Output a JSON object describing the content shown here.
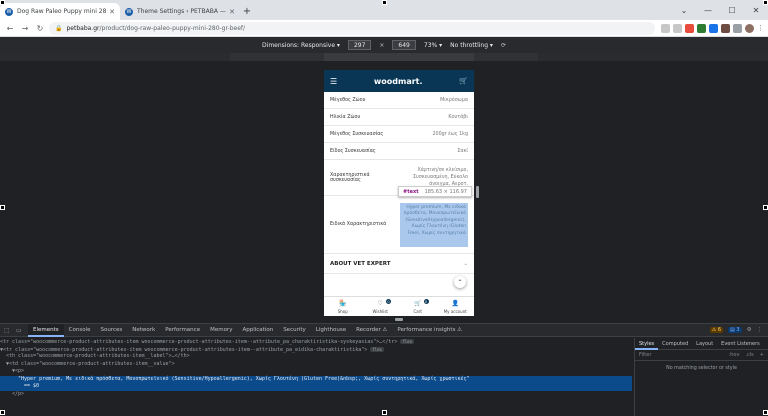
{
  "browser": {
    "tabs": [
      {
        "title": "Dog Raw Paleo Puppy mini 280 g",
        "active": true
      },
      {
        "title": "Theme Settings ‹ PETBABA — W",
        "active": false
      }
    ],
    "new_tab": "+",
    "url_host": "petbaba.gr",
    "url_path": "/product/dog-raw-paleo-puppy-mini-280-gr-beef/"
  },
  "device_toolbar": {
    "dimensions_label": "Dimensions: Responsive ▾",
    "width": "297",
    "height": "649",
    "times": "×",
    "zoom": "73% ▾",
    "throttle": "No throttling ▾"
  },
  "phone": {
    "logo": "woodmart.",
    "rows": [
      {
        "label": "Μέγεθος Ζώου",
        "value": "Μικρόσωμα"
      },
      {
        "label": "Ηλικία Ζώου",
        "value": "Κουτάβι"
      },
      {
        "label": "Μέγεθος Συσκευασίας",
        "value": "200gr έως 1kg"
      },
      {
        "label": "Είδος Συσκευασίας",
        "value": "Σακί"
      }
    ],
    "tall_row": {
      "label": "Χαρακτηριστικά συσκευασίας",
      "value": "Χάρτινη/σε κλείσιμο, Συσκευασμένη, Εύκολο άνοιγμα, Αεροτ."
    },
    "special_row": {
      "label": "Ειδικά Χαρακτηριστικά",
      "value": "Hyper premium, Με ειδικά πρόσθετα, Μονοπρωτεϊνικό (Sensitive/Hypoallergenic), Χωρίς Γλουτένη (Gluten Free), Χωρίς συντηρητικά"
    },
    "tooltip_tag": "#text",
    "tooltip_dims": "185.63 × 116.97",
    "vet_label": "ABOUT VET EXPERT",
    "vet_chevron": "⌄",
    "nav": [
      {
        "icon": "🏪",
        "label": "Shop",
        "badge": ""
      },
      {
        "icon": "♡",
        "label": "Wishlist",
        "badge": "0"
      },
      {
        "icon": "🛒",
        "label": "Cart",
        "badge": "0"
      },
      {
        "icon": "👤",
        "label": "My account",
        "badge": ""
      }
    ]
  },
  "devtools": {
    "tabs": [
      "Elements",
      "Console",
      "Sources",
      "Network",
      "Performance",
      "Memory",
      "Application",
      "Security",
      "Lighthouse",
      "Recorder ⚠",
      "Performance insights ⚠"
    ],
    "active_tab": "Elements",
    "badges": {
      "warnings": "6",
      "issues": "3"
    },
    "lines": [
      {
        "text": "<tr class=\"woocommerce-product-attributes-item woocommerce-product-attributes-item--attribute_pa_charaktiristika-syskeyasias\">…</tr>",
        "pill": "flex",
        "selected": false
      },
      {
        "text": "▼<tr class=\"woocommerce-product-attributes-item woocommerce-product-attributes-item--attribute_pa_eidika-charaktiristika\">",
        "pill": "flex",
        "selected": false
      },
      {
        "text": "  <th class=\"woocommerce-product-attributes-item__label\">…</th>",
        "pill": "",
        "selected": false
      },
      {
        "text": "  ▼<td class=\"woocommerce-product-attributes-item__value\">",
        "pill": "",
        "selected": false
      },
      {
        "text": "    ▼<p>",
        "pill": "",
        "selected": false
      },
      {
        "text": "      \"Hyper premium, Με ειδικά πρόσθετα, Μονοπρωτεϊνικό (Sensitive/Hypoallergenic), Χωρίς Γλουτένη (Gluten Free)&nbsp;, Χωρίς συντηρητικά, Χωρίς χρωστικές\"",
        "pill": "",
        "selected": true
      },
      {
        "text": "      == $0",
        "pill": "",
        "selected": true
      },
      {
        "text": "    </p>",
        "pill": "",
        "selected": false
      }
    ],
    "styles_tabs": [
      "Styles",
      "Computed",
      "Layout",
      "Event Listeners"
    ],
    "filter_placeholder": "Filter",
    "filter_hov": ":hov",
    "filter_cls": ".cls",
    "no_match": "No matching selector or style"
  }
}
